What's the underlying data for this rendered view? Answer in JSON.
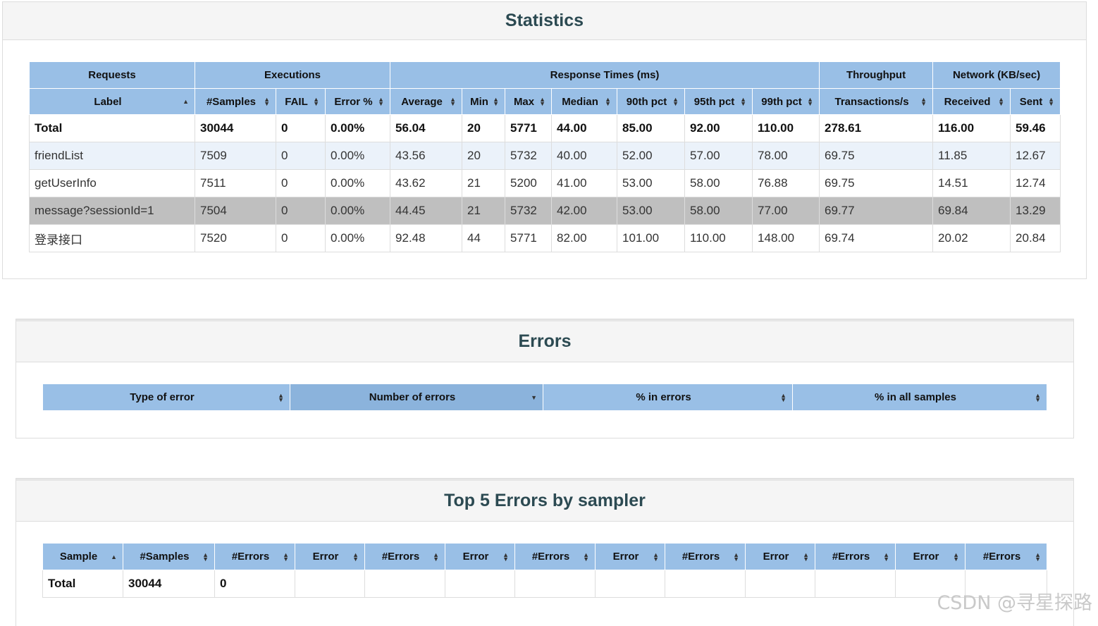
{
  "statistics": {
    "title": "Statistics",
    "groups": [
      "Requests",
      "Executions",
      "Response Times (ms)",
      "Throughput",
      "Network (KB/sec)"
    ],
    "columns": [
      "Label",
      "#Samples",
      "FAIL",
      "Error %",
      "Average",
      "Min",
      "Max",
      "Median",
      "90th pct",
      "95th pct",
      "99th pct",
      "Transactions/s",
      "Received",
      "Sent"
    ],
    "rows": [
      [
        "Total",
        "30044",
        "0",
        "0.00%",
        "56.04",
        "20",
        "5771",
        "44.00",
        "85.00",
        "92.00",
        "110.00",
        "278.61",
        "116.00",
        "59.46"
      ],
      [
        "friendList",
        "7509",
        "0",
        "0.00%",
        "43.56",
        "20",
        "5732",
        "40.00",
        "52.00",
        "57.00",
        "78.00",
        "69.75",
        "11.85",
        "12.67"
      ],
      [
        "getUserInfo",
        "7511",
        "0",
        "0.00%",
        "43.62",
        "21",
        "5200",
        "41.00",
        "53.00",
        "58.00",
        "76.88",
        "69.75",
        "14.51",
        "12.74"
      ],
      [
        "message?sessionId=1",
        "7504",
        "0",
        "0.00%",
        "44.45",
        "21",
        "5732",
        "42.00",
        "53.00",
        "58.00",
        "77.00",
        "69.77",
        "69.84",
        "13.29"
      ],
      [
        "登录接口",
        "7520",
        "0",
        "0.00%",
        "92.48",
        "44",
        "5771",
        "82.00",
        "101.00",
        "110.00",
        "148.00",
        "69.74",
        "20.02",
        "20.84"
      ]
    ]
  },
  "errors": {
    "title": "Errors",
    "columns": [
      "Type of error",
      "Number of errors",
      "% in errors",
      "% in all samples"
    ]
  },
  "top5": {
    "title": "Top 5 Errors by sampler",
    "columns": [
      "Sample",
      "#Samples",
      "#Errors",
      "Error",
      "#Errors",
      "Error",
      "#Errors",
      "Error",
      "#Errors",
      "Error",
      "#Errors",
      "Error",
      "#Errors"
    ],
    "rows": [
      [
        "Total",
        "30044",
        "0",
        "",
        "",
        "",
        "",
        "",
        "",
        "",
        "",
        "",
        ""
      ]
    ]
  },
  "watermark": "CSDN @寻星探路",
  "colors": {
    "header": "#99bfe6",
    "header_active": "#8bb3dc",
    "row_alt": "#ebf2fa",
    "row_highlight": "#bfbfbf",
    "title": "#2c4a52"
  }
}
